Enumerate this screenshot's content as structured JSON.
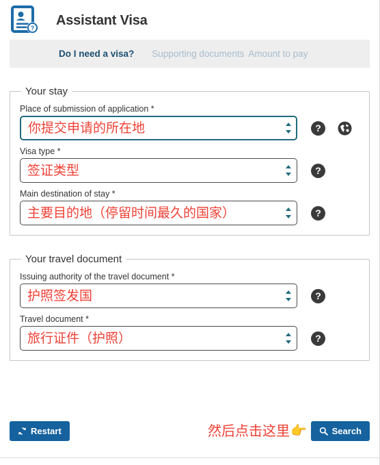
{
  "header": {
    "title": "Assistant Visa",
    "icon": "id-card-question-icon",
    "icon_color": "#1d6ca8"
  },
  "tabs": [
    {
      "label": "Do I need a visa?",
      "state": "active"
    },
    {
      "label": "Supporting documents",
      "state": "disabled"
    },
    {
      "label": "Amount to pay",
      "state": "disabled"
    }
  ],
  "groups": [
    {
      "legend": "Your stay",
      "fields": [
        {
          "label": "Place of submission of application *",
          "value": "你提交申请的所在地",
          "focused": true,
          "help": "question-mark-icon",
          "extra": "globe-icon"
        },
        {
          "label": "Visa type *",
          "value": "签证类型",
          "focused": false,
          "help": "question-mark-icon"
        },
        {
          "label": "Main destination of stay *",
          "value": "主要目的地（停留时间最久的国家）",
          "focused": false,
          "help": "question-mark-icon"
        }
      ]
    },
    {
      "legend": "Your travel document",
      "fields": [
        {
          "label": "Issuing authority of the travel document *",
          "value": "护照签发国",
          "focused": false,
          "help": "question-mark-icon"
        },
        {
          "label": "Travel document *",
          "value": "旅行证件（护照）",
          "focused": false,
          "help": "question-mark-icon"
        }
      ]
    }
  ],
  "footer": {
    "restart_label": "Restart",
    "restart_icon": "refresh-icon",
    "search_label": "Search",
    "search_icon": "magnifier-icon",
    "annotation_text": "然后点击这里",
    "annotation_hand": "👉",
    "annotation_color": "#ef4136",
    "button_color": "#15629e"
  },
  "help_glyph": "?"
}
